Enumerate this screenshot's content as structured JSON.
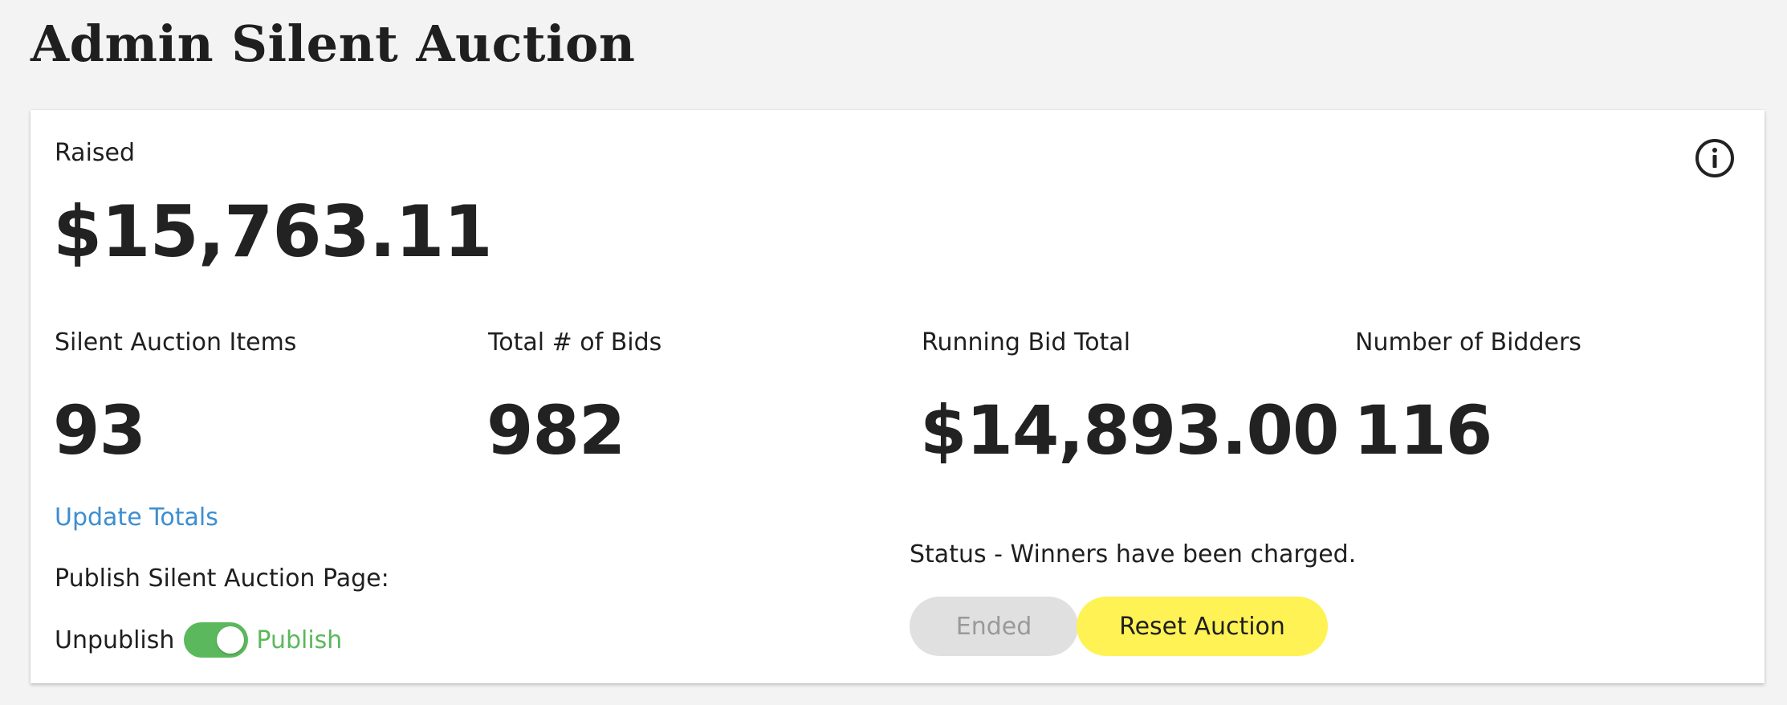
{
  "page": {
    "title": "Admin Silent Auction"
  },
  "colors": {
    "link": "#3d8ed1",
    "toggle_on": "#5cb85c",
    "ended_bg": "#e0e0e0",
    "ended_text": "#999999",
    "reset_bg": "#fff254",
    "reset_text": "#1f1f1f"
  },
  "summary": {
    "info_icon": "info-icon",
    "raised_label": "Raised",
    "raised_value": "$15,763.11"
  },
  "stats": {
    "items_label": "Silent Auction Items",
    "items_value": "93",
    "bids_label": "Total # of Bids",
    "bids_value": "982",
    "running_label": "Running Bid Total",
    "running_value": "$14,893.00",
    "bidders_label": "Number of Bidders",
    "bidders_value": "116"
  },
  "actions": {
    "update_totals_label": "Update Totals"
  },
  "publish": {
    "heading": "Publish Silent Auction Page:",
    "off_label": "Unpublish",
    "on_label": "Publish",
    "state": "on"
  },
  "auction_status": {
    "status_text": "Status - Winners have been charged.",
    "ended_label": "Ended",
    "reset_label": "Reset Auction"
  }
}
